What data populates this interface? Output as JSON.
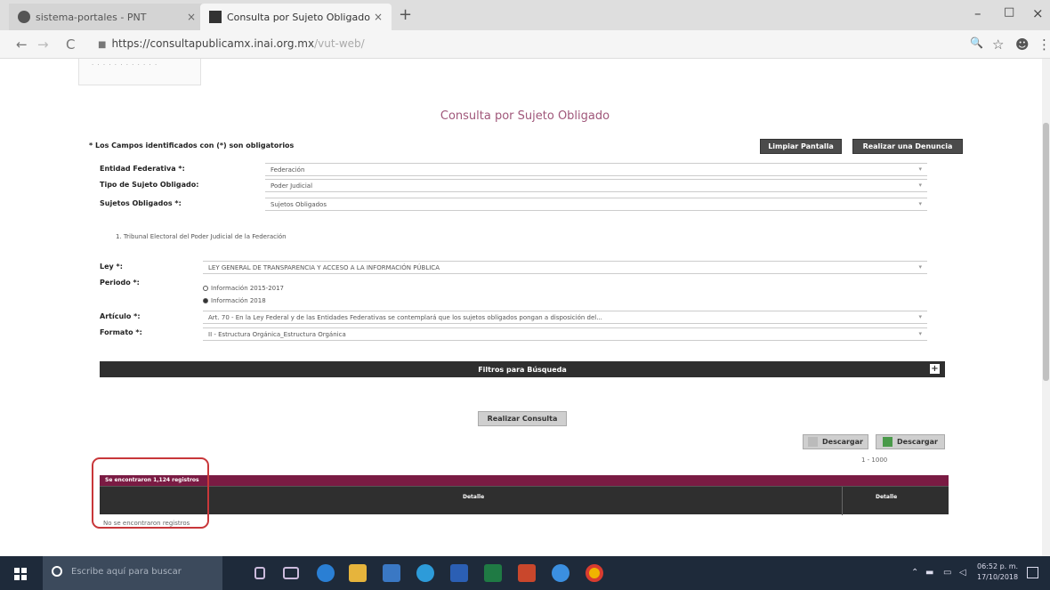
{
  "browser": {
    "tabs": [
      {
        "label": "sistema-portales - PNT",
        "close": "×"
      },
      {
        "label": "Consulta por Sujeto Obligado",
        "close": "×"
      }
    ],
    "new_tab": "+",
    "window_controls": {
      "minimize": "–",
      "maximize": "□",
      "close": "×"
    },
    "nav": {
      "back": "←",
      "forward": "→",
      "reload": "C"
    },
    "url": {
      "host": "https://consultapublicamx.inai.org.mx",
      "path": "/vut-web/"
    },
    "icons": {
      "zoom": "🔍",
      "star": "☆",
      "account": "☻",
      "menu": "⋮"
    }
  },
  "page": {
    "title": "Consulta por Sujeto Obligado",
    "required_note": "* Los Campos identificados con (*) son obligatorios",
    "buttons": {
      "clear": "Limpiar Pantalla",
      "report": "Realizar una Denuncia",
      "query": "Realizar Consulta",
      "download1": "Descargar",
      "download2": "Descargar"
    },
    "fields": {
      "entidad": {
        "label": "Entidad Federativa *:",
        "value": "Federación"
      },
      "tipo": {
        "label": "Tipo de Sujeto Obligado:",
        "value": "Poder Judicial"
      },
      "sujetos": {
        "label": "Sujetos Obligados *:",
        "value": "Sujetos Obligados"
      },
      "selected_subject": "1. Tribunal Electoral del Poder Judicial de la Federación",
      "ley": {
        "label": "Ley *:",
        "value": "LEY GENERAL DE TRANSPARENCIA Y ACCESO A LA INFORMACIÓN PÚBLICA"
      },
      "periodo": {
        "label": "Periodo *:",
        "options": [
          "Información 2015-2017",
          "Información 2018"
        ],
        "selected": "Información 2018"
      },
      "articulo": {
        "label": "Artículo *:",
        "value": "Art. 70 - En la Ley Federal y de las Entidades Federativas se contemplará que los sujetos obligados pongan a disposición del..."
      },
      "formato": {
        "label": "Formato *:",
        "value": "II - Estructura Orgánica_Estructura Orgánica"
      }
    },
    "filters_bar": "Filtros para Búsqueda",
    "filters_toggle": "+",
    "range": "1 - 1000",
    "results": {
      "count_text": "Se encontraron 1,124 registros",
      "columns": [
        "Detalle",
        "Detalle"
      ],
      "empty_text": "No se encontraron registros"
    }
  },
  "taskbar": {
    "search_placeholder": "Escribe aquí para buscar",
    "time": "06:52 p. m.",
    "date": "17/10/2018"
  },
  "colors": {
    "accent": "#7a1b43",
    "title": "#a0577a",
    "dark_bar": "#2f2f2f",
    "highlight": "#c8373a",
    "taskbar": "#1e2a3a"
  }
}
